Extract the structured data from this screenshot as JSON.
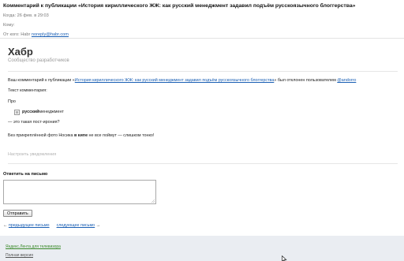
{
  "mail": {
    "subject": "Комментарий к публикации «История кириллического ЖЖ: как русский менеджмент задавил подъём русскоязычного блоггерства»",
    "when_label": "Когда:",
    "when_value": "26 фев. в 29:03",
    "to_label": "Кому:",
    "from_label": "От кого:",
    "from_name": "Habr",
    "from_email": "noreply@habr.com"
  },
  "brand": {
    "name": "Хабр",
    "tagline": "Сообщество разработчиков"
  },
  "message": {
    "intro_prefix": "Ваш комментарий к публикации «",
    "post_link": "История кириллического ЖЖ: как русский менеджмент задавил подъём русскоязычного блоггерства",
    "intro_middle": "» был отклонен пользователем ",
    "moderator": "@andorro",
    "comment_label": "Текст комментария:",
    "pro": "Про",
    "img_bold": "русский",
    "img_text": " менеджмент",
    "irony": "— это такая пост-ирония?",
    "bottom_prefix": "Без прикреплённой фото Носика ",
    "bottom_bold": "в кипе",
    "bottom_suffix": " не все поймут — слишком тонко!",
    "notify": "Настроить уведомления"
  },
  "reply": {
    "label": "Ответить на письмо",
    "textarea_value": "",
    "send": "Отправить",
    "prev_arrow": "←",
    "prev": "предыдущее письмо",
    "next": "следующее письмо",
    "next_arrow": "→"
  },
  "footer": {
    "tv_link": "Яндекс.Лента для телевизора",
    "full_version": "Полная версия"
  },
  "colors": {
    "link": "#1a5fb4",
    "footer_bg": "#eaedf2",
    "footer_link": "#3a8a2a"
  }
}
